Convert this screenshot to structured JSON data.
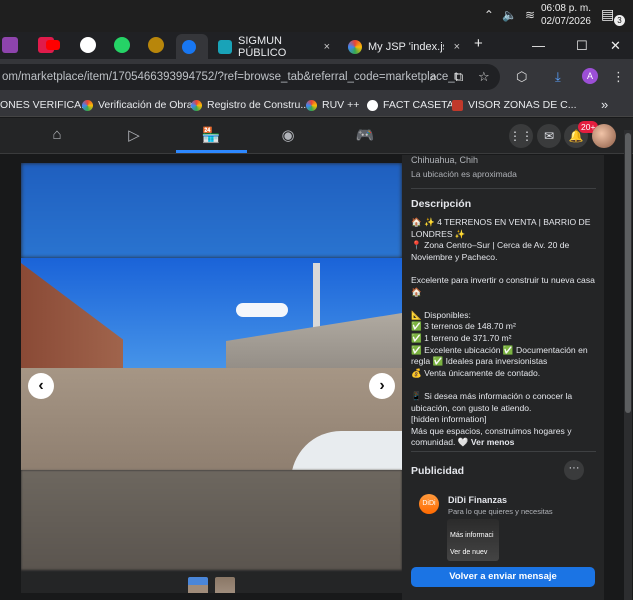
{
  "system": {
    "time": "06:08 p. m.",
    "date": "02/07/2026",
    "notification_count": "3"
  },
  "tabs": [
    {
      "label": "SIGMUN PÚBLICO",
      "close": "×"
    },
    {
      "label": "My JSP 'index.jsp' s",
      "close": "×"
    }
  ],
  "new_tab": "+",
  "window": {
    "minimize": "—",
    "maximize": "☐",
    "close": "✕"
  },
  "address": {
    "url_prefix": "om/marketplace/item/1705466393994752/?ref=browse_tab&referral_code=marketplace_t"
  },
  "bookmarks": [
    "ONES VERIFICA...",
    "Verificación de Obra",
    "Registro de Constru...",
    "RUV ++",
    "FACT CASETAS",
    "VISOR ZONAS DE C..."
  ],
  "bookmarks_more": "»",
  "nav": {
    "notifications_badge": "20+"
  },
  "profile_initial": "A",
  "listing": {
    "location_line": "Chihuahua, Chih",
    "location_note": "La ubicación es aproximada",
    "description_heading": "Descripción",
    "description": "🏠 ✨ 4 TERRENOS EN VENTA | BARRIO DE LONDRES ✨\n📍 Zona Centro–Sur | Cerca de Av. 20 de Noviembre y Pacheco.\n\nExcelente para invertir o construir tu nueva casa 🏠\n\n📐 Disponibles:\n✅ 3 terrenos de 148.70 m²\n✅ 1 terreno de 371.70 m²\n✅ Excelente ubicación ✅ Documentación en regla ✅ Ideales para inversionistas\n💰 Venta únicamente de contado.\n\n📱 Si desea más información o conocer la ubicación, con gusto le atiendo.\n[hidden information]\nMás que espacios, construimos hogares y comunidad. 🤍",
    "see_less": "Ver menos"
  },
  "ads": {
    "heading": "Publicidad",
    "more": "···",
    "advertiser": "DiDi Finanzas",
    "logo_text": "DiDi",
    "tagline": "Para lo que quieres y necesitas",
    "image_text_1": "Más informaci",
    "image_text_2": "Ver de nuev"
  },
  "cta_label": "Volver a enviar mensaje",
  "carousel": {
    "prev": "‹",
    "next": "›"
  }
}
